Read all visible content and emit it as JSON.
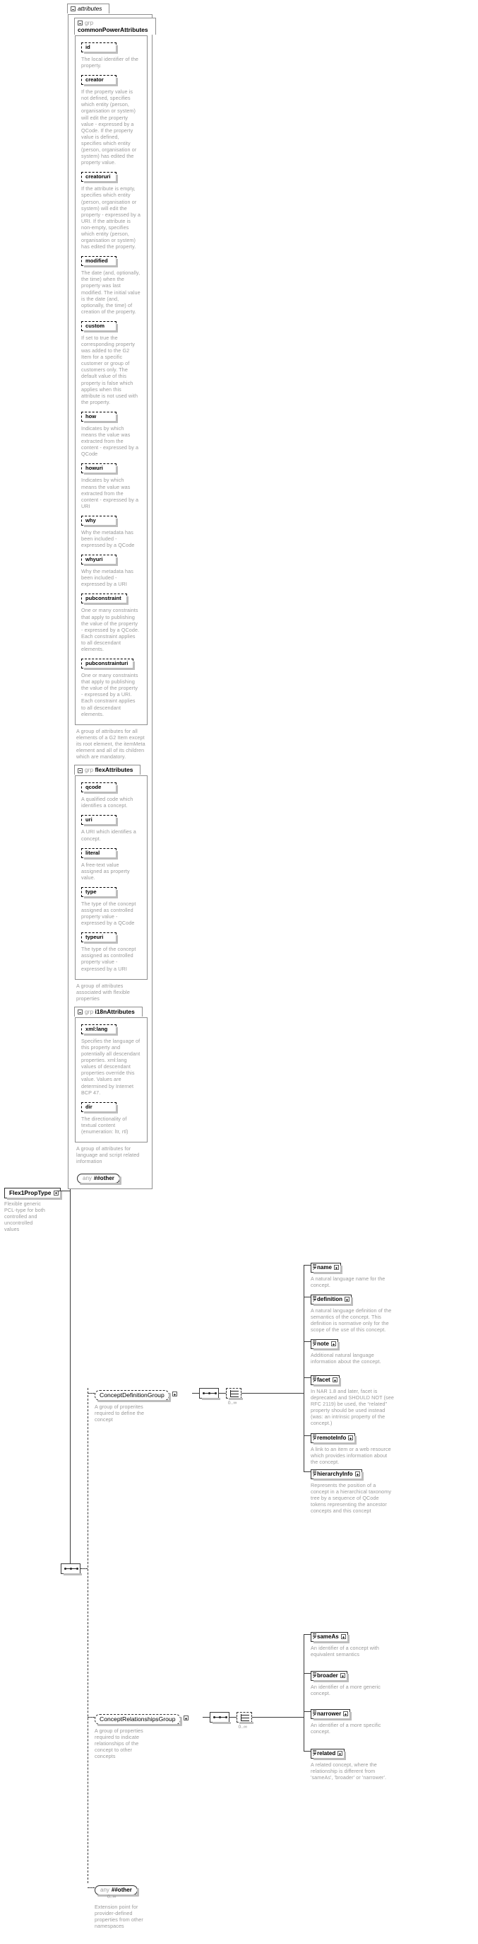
{
  "diagram": {
    "type": "xml-schema-documentation",
    "root_type": {
      "name": "Flex1PropType",
      "doc": "Flexible generic PCL-type for both controlled and uncontrolled values"
    },
    "attributes_panel": {
      "tab_label": "attributes",
      "groups": [
        {
          "keyword": "grp",
          "name": "commonPowerAttributes",
          "doc": "A group of attributes for all elements of a G2 Item except its root element, the itemMeta element and all of its children which are mandatory.",
          "attributes": [
            {
              "name": "id",
              "doc": "The local identifier of the property."
            },
            {
              "name": "creator",
              "doc": "If the property value is not defined, specifies which entity (person, organisation or system) will edit the property value - expressed by a QCode. If the property value is defined, specifies which entity (person, organisation or system) has edited the property value."
            },
            {
              "name": "creatoruri",
              "doc": "If the attribute is empty, specifies which entity (person, organisation or system) will edit the property - expressed by a URI. If the attribute is non-empty, specifies which entity (person, organisation or system) has edited the property."
            },
            {
              "name": "modified",
              "doc": "The date (and, optionally, the time) when the property was last modified. The initial value is the date (and, optionally, the time) of creation of the property."
            },
            {
              "name": "custom",
              "doc": "If set to true the corresponding property was added to the G2 Item for a specific customer or group of customers only. The default value of this property is false which applies when this attribute is not used with the property."
            },
            {
              "name": "how",
              "doc": "Indicates by which means the value was extracted from the content - expressed by a QCode"
            },
            {
              "name": "howuri",
              "doc": "Indicates by which means the value was extracted from the content - expressed by a URI"
            },
            {
              "name": "why",
              "doc": "Why the metadata has been included - expressed by a QCode"
            },
            {
              "name": "whyuri",
              "doc": "Why the metadata has been included - expressed by a URI"
            },
            {
              "name": "pubconstraint",
              "doc": "One or many constraints that apply to publishing the value of the property - expressed by a QCode. Each constraint applies to all descendant elements."
            },
            {
              "name": "pubconstrainturi",
              "doc": "One or many constraints that apply to publishing the value of the property - expressed by a URI. Each constraint applies to all descendant elements."
            }
          ]
        },
        {
          "keyword": "grp",
          "name": "flexAttributes",
          "doc": "A group of attributes associated with flexible properties",
          "attributes": [
            {
              "name": "qcode",
              "doc": "A qualified code which identifies a concept."
            },
            {
              "name": "uri",
              "doc": "A URI which identifies a concept."
            },
            {
              "name": "literal",
              "doc": "A free-text value assigned as property value."
            },
            {
              "name": "type",
              "doc": "The type of the concept assigned as controlled property value - expressed by a QCode"
            },
            {
              "name": "typeuri",
              "doc": "The type of the concept assigned as controlled property value - expressed by a URI"
            }
          ]
        },
        {
          "keyword": "grp",
          "name": "i18nAttributes",
          "doc": "A group of attributes for language and script related information",
          "attributes": [
            {
              "name": "xml:lang",
              "doc": "Specifies the language of this property and potentially all descendant properties. xml:lang values of descendant properties override this value. Values are determined by Internet BCP 47."
            },
            {
              "name": "dir",
              "doc": "The directionality of textual content (enumeration: ltr, rtl)"
            }
          ]
        }
      ],
      "any_attribute": {
        "keyword": "any",
        "name": "##other"
      }
    },
    "content_model": {
      "branches": [
        {
          "id": "concept-definition-group",
          "ref_label": "ConceptDefinitionGroup",
          "doc": "A group of properites required to define the concept",
          "compositor": "sequence",
          "choice_occurs": "0..∞",
          "elements": [
            {
              "name": "name",
              "doc": "A natural language name for the concept."
            },
            {
              "name": "definition",
              "doc": "A natural language definition of the semantics of the concept. This definition is normative only for the scope of the use of this concept."
            },
            {
              "name": "note",
              "doc": "Additional natural language information about the concept."
            },
            {
              "name": "facet",
              "doc": "In NAR 1.8 and later, facet is deprecated and SHOULD NOT (see RFC 2119) be used, the “related” property should be used instead (was: an intrinsic property of the concept.)"
            },
            {
              "name": "remoteInfo",
              "doc": "A link to an item or a web resource which provides information about the concept."
            },
            {
              "name": "hierarchyInfo",
              "doc": "Represents the position of a concept in a hierarchical taxonomy tree by a sequence of QCode tokens representing the ancestor concepts and this concept"
            }
          ]
        },
        {
          "id": "concept-relationships-group",
          "ref_label": "ConceptRelationshipsGroup",
          "doc": "A group of properties required to indicate relationships of the concept to other concepts",
          "compositor": "sequence",
          "choice_occurs": "0..∞",
          "elements": [
            {
              "name": "sameAs",
              "doc": "An identifier of a concept with equivalent semantics"
            },
            {
              "name": "broader",
              "doc": "An identifier of a more generic concept."
            },
            {
              "name": "narrower",
              "doc": "An identifier of a more specific concept."
            },
            {
              "name": "related",
              "doc": "A related concept, where the relationship is different from 'sameAs', 'broader' or 'narrower'."
            }
          ]
        },
        {
          "id": "any-other",
          "ref_label": "##other",
          "keyword": "any",
          "occurs": "0..∞",
          "doc": "Extension point for provider-defined properties from other namespaces"
        }
      ]
    }
  }
}
